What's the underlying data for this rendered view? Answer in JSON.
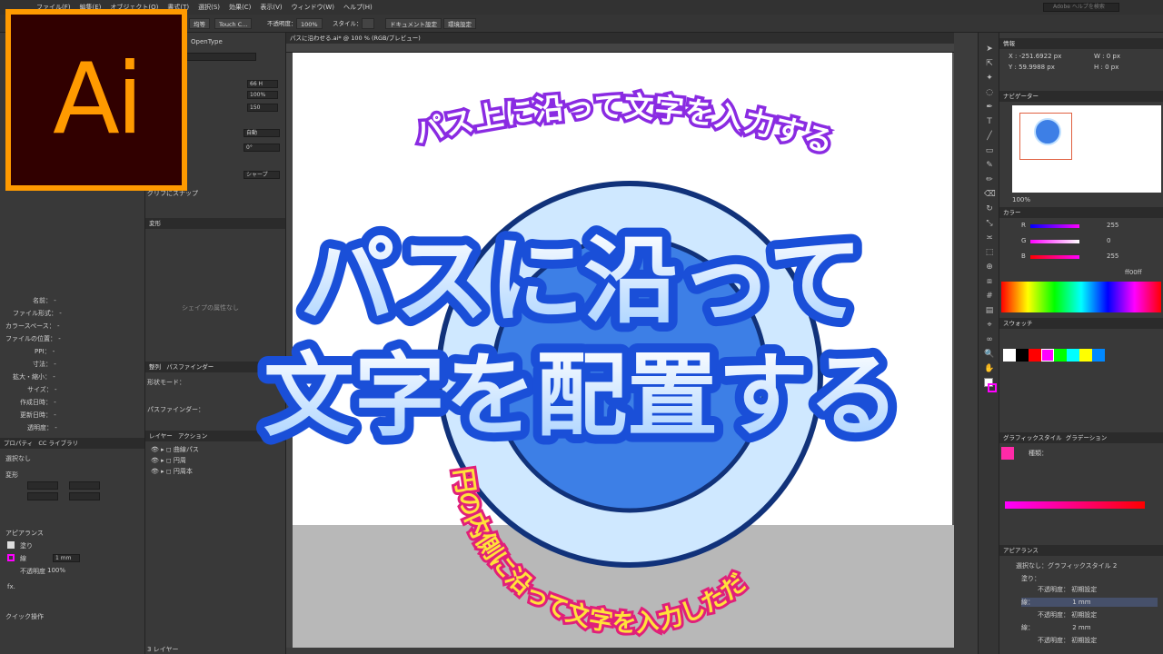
{
  "menubar": {
    "items": [
      "ファイル(F)",
      "編集(E)",
      "オブジェクト(O)",
      "書式(T)",
      "選択(S)",
      "効果(C)",
      "表示(V)",
      "ウィンドウ(W)",
      "ヘルプ(H)"
    ],
    "search_placeholder": "Adobe ヘルプを検索"
  },
  "controlbar": {
    "stroke_style": "均等",
    "brush": "Touch C...",
    "opacity_label": "不透明度：",
    "opacity_value": "100%",
    "style_label": "スタイル：",
    "doc_settings": "ドキュメント設定",
    "env_settings": "環境設定"
  },
  "logo": {
    "text": "Ai",
    "bg": "#310000",
    "border": "#ff9a00"
  },
  "document_tab": "パスに沿わせる.ai* @ 100 % (RGB/プレビュー)",
  "left_panel": {
    "opentype_tab": "OpenType",
    "char_fields": [
      "66 H",
      "100%",
      "150",
      "自動",
      "0°",
      "シャープ"
    ],
    "glyph_snap": "グリフにスナップ",
    "transform_tab": "変形",
    "no_shape_props": "シェイプの属性なし",
    "pathfinder_tabs": [
      "整列",
      "パスファインダー"
    ],
    "shape_mode": "形状モード：",
    "pathfinder_label": "パスファインダー：",
    "file_info": [
      {
        "label": "名前：",
        "value": "-"
      },
      {
        "label": "ファイル形式：",
        "value": "-"
      },
      {
        "label": "カラースペース：",
        "value": "-"
      },
      {
        "label": "ファイルの位置：",
        "value": "-"
      },
      {
        "label": "PPI：",
        "value": "-"
      },
      {
        "label": "寸法：",
        "value": "-"
      },
      {
        "label": "拡大・縮小：",
        "value": "-"
      },
      {
        "label": "サイズ：",
        "value": "-"
      },
      {
        "label": "作成日時：",
        "value": "-"
      },
      {
        "label": "更新日時：",
        "value": "-"
      },
      {
        "label": "透明度：",
        "value": "-"
      }
    ],
    "properties_tabs": [
      "プロパティ",
      "CC ライブラリ"
    ],
    "no_selection": "選択なし",
    "transform_label": "変形",
    "appearance_label": "アピアランス",
    "fill_label": "塗り",
    "stroke_label": "線",
    "stroke_weight": "1 mm",
    "opacity_label": "不透明度",
    "opacity_value": "100%",
    "fx": "fx.",
    "quick_actions": "クイック操作"
  },
  "layers_panel": {
    "tabs": [
      "レイヤー",
      "アクション"
    ],
    "layers": [
      "曲線パス",
      "円周",
      "円周本"
    ],
    "footer": "3 レイヤー"
  },
  "canvas": {
    "top_arc_text": "パス上に沿って文字を入力する",
    "inner_arc_text": "円の内側に沿って文字を入力しただ",
    "title_line1": "パスに沿って",
    "title_line2": "文字を配置する"
  },
  "right_panel": {
    "info_tab": "情報",
    "x_value": "X : -251.6922 px",
    "y_value": "Y : 59.9988 px",
    "w_value": "W : 0 px",
    "h_value": "H : 0 px",
    "navigator_tab": "ナビゲーター",
    "zoom": "100%",
    "color_tab": "カラー",
    "r_label": "R",
    "r_value": "255",
    "g_label": "G",
    "g_value": "0",
    "b_label": "B",
    "b_value": "255",
    "hex_value": "ff00ff",
    "swatches_tab": "スウォッチ",
    "gradient_tabs": [
      "グラフィックスタイル",
      "グラデーション"
    ],
    "gradient_type": "種類：",
    "appearance_tab": "アピアランス",
    "app_title": "選択なし：グラフィックスタイル 2",
    "app_rows": [
      {
        "label": "塗り：",
        "value": ""
      },
      {
        "label": "不透明度：",
        "value": "初期設定"
      },
      {
        "label": "線：",
        "value": "1 mm"
      },
      {
        "label": "不透明度：",
        "value": "初期設定"
      },
      {
        "label": "線：",
        "value": "2 mm"
      },
      {
        "label": "不透明度：",
        "value": "初期設定"
      }
    ]
  },
  "colors": {
    "accent": "#ff00ff",
    "title_blue": "#1a4fd8",
    "circle_fill": "#3d7fe6"
  }
}
